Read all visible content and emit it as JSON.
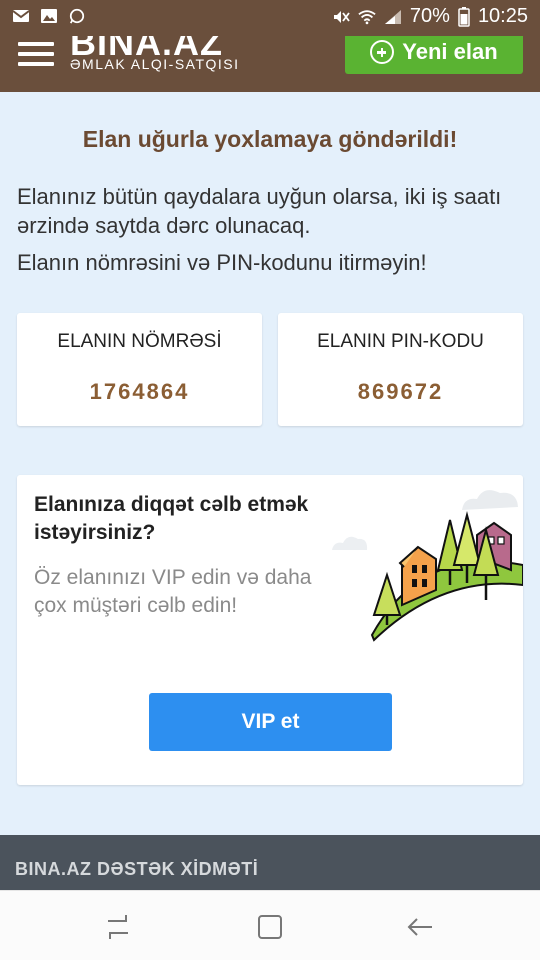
{
  "status_bar": {
    "battery": "70%",
    "time": "10:25",
    "icons": [
      "mail-icon",
      "image-icon",
      "whatsapp-icon",
      "mute-icon",
      "wifi-icon",
      "signal-icon",
      "battery-icon"
    ]
  },
  "header": {
    "logo": "BINA.AZ",
    "tagline": "ƏMLAK ALQI-SATQISI",
    "new_button": "Yeni elan",
    "colors": {
      "bg": "#6a4f3c",
      "button": "#5ab332"
    }
  },
  "main": {
    "title": "Elan uğurla yoxlamaya göndərildi!",
    "info_line1": "Elanınız bütün qaydalara uyğun olarsa, iki iş saatı ərzində saytda dərc olunacaq.",
    "info_line2": "Elanın nömrəsini və PIN-kodunu itirməyin!",
    "ad_number_label": "ELANIN NÖMRƏSİ",
    "ad_number": "1764864",
    "pin_label": "ELANIN PIN-KODU",
    "pin": "869672"
  },
  "vip": {
    "title": "Elanınıza diqqət cəlb etmək istəyirsiniz?",
    "description": "Öz elanınızı VIP edin və daha çox müştəri cəlb edin!",
    "button": "VIP et",
    "colors": {
      "button": "#2d8ff0"
    }
  },
  "support": {
    "title": "BINA.AZ DƏSTƏK XİDMƏTİ"
  },
  "navbar": {
    "icons": [
      "recent-apps-icon",
      "home-icon",
      "back-icon"
    ]
  }
}
